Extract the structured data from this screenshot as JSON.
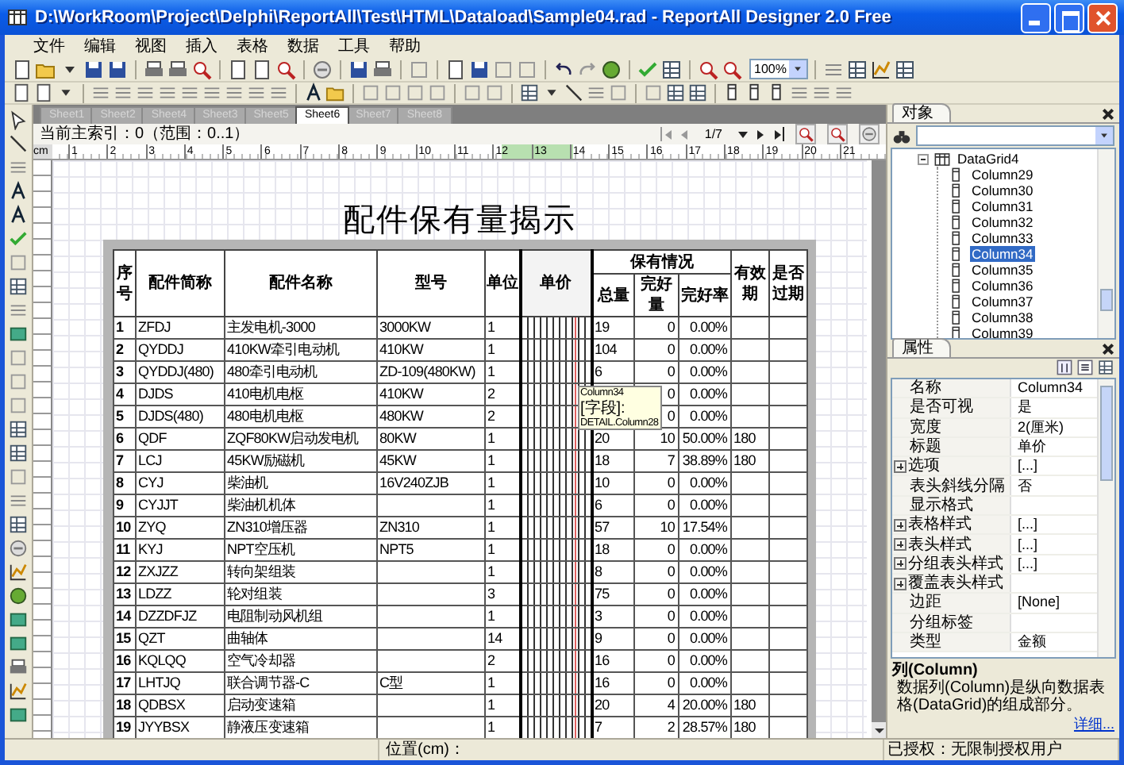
{
  "window": {
    "title": "D:\\WorkRoom\\Project\\Delphi\\ReportAll\\Test\\HTML\\Dataload\\Sample04.rad - ReportAll Designer 2.0 Free"
  },
  "menu": [
    "文件",
    "编辑",
    "视图",
    "插入",
    "表格",
    "数据",
    "工具",
    "帮助"
  ],
  "toolbar": {
    "zoom": "100%"
  },
  "sheet_tabs": [
    {
      "label": "Sheet1",
      "selected": false
    },
    {
      "label": "Sheet2",
      "selected": false
    },
    {
      "label": "Sheet4",
      "selected": false
    },
    {
      "label": "Sheet3",
      "selected": false
    },
    {
      "label": "Sheet5",
      "selected": false
    },
    {
      "label": "Sheet6",
      "selected": true
    },
    {
      "label": "Sheet7",
      "selected": false
    },
    {
      "label": "Sheet8",
      "selected": false
    }
  ],
  "info_bar": {
    "index_text": "当前主索引：0（范围：0..1）",
    "page": "1/7"
  },
  "ruler": {
    "unit": "cm",
    "marks": [
      "1",
      "2",
      "3",
      "4",
      "5",
      "6",
      "7",
      "8",
      "9",
      "10",
      "11",
      "12",
      "13",
      "14",
      "15",
      "16",
      "17",
      "18",
      "19",
      "20",
      "21"
    ]
  },
  "report": {
    "title": "配件保有量揭示",
    "header": [
      {
        "label": "序号",
        "selected": false
      },
      {
        "label": "配件简称",
        "selected": false
      },
      {
        "label": "配件名称",
        "selected": false
      },
      {
        "label": "型号",
        "selected": false
      },
      {
        "label": "单位",
        "selected": false
      },
      {
        "label": "单价",
        "selected": true
      },
      {
        "label": "保有情况",
        "children": [
          {
            "label": "总量",
            "selected": false
          },
          {
            "label": "完好量",
            "selected": false
          },
          {
            "label": "完好率",
            "selected": false
          }
        ]
      },
      {
        "label": "有效期",
        "selected": false
      },
      {
        "label": "是否过期",
        "selected": false
      }
    ],
    "rows": [
      [
        "1",
        "ZFDJ",
        "主发电机-3000",
        "3000KW",
        "1",
        null,
        "19",
        "0",
        "0.00%",
        null,
        null
      ],
      [
        "2",
        "QYDDJ",
        "410KW牵引电动机",
        "410KW",
        "1",
        null,
        "104",
        "0",
        "0.00%",
        null,
        null
      ],
      [
        "3",
        "QYDDJ(480)",
        "480牵引电动机",
        "ZD-109(480KW)",
        "1",
        null,
        "6",
        "0",
        "0.00%",
        null,
        null
      ],
      [
        "4",
        "DJDS",
        "410电机电枢",
        "410KW",
        "2",
        null,
        null,
        "0",
        "0.00%",
        null,
        null
      ],
      [
        "5",
        "DJDS(480)",
        "480电机电枢",
        "480KW",
        "2",
        null,
        null,
        "0",
        "0.00%",
        null,
        null
      ],
      [
        "6",
        "QDF",
        "ZQF80KW启动发电机",
        "80KW",
        "1",
        null,
        "20",
        "10",
        "50.00%",
        "180",
        null
      ],
      [
        "7",
        "LCJ",
        "45KW励磁机",
        "45KW",
        "1",
        null,
        "18",
        "7",
        "38.89%",
        "180",
        null
      ],
      [
        "8",
        "CYJ",
        "柴油机",
        "16V240ZJB",
        "1",
        null,
        "10",
        "0",
        "0.00%",
        null,
        null
      ],
      [
        "9",
        "CYJJT",
        "柴油机机体",
        null,
        "1",
        null,
        "6",
        "0",
        "0.00%",
        null,
        null
      ],
      [
        "10",
        "ZYQ",
        "ZN310增压器",
        "ZN310",
        "1",
        null,
        "57",
        "10",
        "17.54%",
        null,
        null
      ],
      [
        "11",
        "KYJ",
        "NPT空压机",
        "NPT5",
        "1",
        null,
        "18",
        "0",
        "0.00%",
        null,
        null
      ],
      [
        "12",
        "ZXJZZ",
        "转向架组装",
        null,
        "1",
        null,
        "8",
        "0",
        "0.00%",
        null,
        null
      ],
      [
        "13",
        "LDZZ",
        "轮对组装",
        null,
        "3",
        null,
        "75",
        "0",
        "0.00%",
        null,
        null
      ],
      [
        "14",
        "DZZDFJZ",
        "电阻制动风机组",
        null,
        "1",
        null,
        "3",
        "0",
        "0.00%",
        null,
        null
      ],
      [
        "15",
        "QZT",
        "曲轴体",
        null,
        "14",
        null,
        "9",
        "0",
        "0.00%",
        null,
        null
      ],
      [
        "16",
        "KQLQQ",
        "空气冷却器",
        null,
        "2",
        null,
        "16",
        "0",
        "0.00%",
        null,
        null
      ],
      [
        "17",
        "LHTJQ",
        "联合调节器-C",
        "C型",
        "1",
        null,
        "16",
        "0",
        "0.00%",
        null,
        null
      ],
      [
        "18",
        "QDBSX",
        "启动变速箱",
        null,
        "1",
        null,
        "20",
        "4",
        "20.00%",
        "180",
        null
      ],
      [
        "19",
        "JYYBSX",
        "静液压变速箱",
        null,
        "1",
        null,
        "7",
        "2",
        "28.57%",
        "180",
        null
      ]
    ]
  },
  "tooltip": {
    "lines": [
      "Column34",
      "[字段]:",
      "DETAIL.Column28"
    ]
  },
  "object_panel": {
    "tab": "对象",
    "tree": [
      {
        "label": "DataGrid4",
        "expanded": true,
        "children": [
          {
            "label": "Column29",
            "selected": false
          },
          {
            "label": "Column30",
            "selected": false
          },
          {
            "label": "Column31",
            "selected": false
          },
          {
            "label": "Column32",
            "selected": false
          },
          {
            "label": "Column33",
            "selected": false
          },
          {
            "label": "Column34",
            "selected": true
          },
          {
            "label": "Column35",
            "selected": false
          },
          {
            "label": "Column36",
            "selected": false
          },
          {
            "label": "Column37",
            "selected": false
          },
          {
            "label": "Column38",
            "selected": false
          },
          {
            "label": "Column39",
            "selected": false
          }
        ]
      }
    ]
  },
  "property_panel": {
    "tab": "属性",
    "properties": [
      {
        "name": "名称",
        "value": "Column34",
        "expandable": false
      },
      {
        "name": "是否可视",
        "value": "是",
        "expandable": false
      },
      {
        "name": "宽度",
        "value": "2(厘米)",
        "expandable": false
      },
      {
        "name": "标题",
        "value": "单价",
        "expandable": false
      },
      {
        "name": "选项",
        "value": "[...]",
        "expandable": true
      },
      {
        "name": "表头斜线分隔",
        "value": "否",
        "expandable": false
      },
      {
        "name": "显示格式",
        "expandable": false
      },
      {
        "name": "表格样式",
        "value": "[...]",
        "expandable": true
      },
      {
        "name": "表头样式",
        "value": "[...]",
        "expandable": true
      },
      {
        "name": "分组表头样式",
        "value": "[...]",
        "expandable": true
      },
      {
        "name": "覆盖表头样式",
        "expandable": true
      },
      {
        "name": "边距",
        "value": "[None]",
        "expandable": false
      },
      {
        "name": "分组标签",
        "expandable": false
      },
      {
        "name": "类型",
        "value": "金额",
        "expandable": false
      }
    ],
    "description": {
      "title": "列(Column)",
      "text": "数据列(Column)是纵向数据表格(DataGrid)的组成部分。",
      "link": "详细..."
    }
  },
  "status_bar": {
    "position_label": "位置(cm)：",
    "license": "已授权：无限制授权用户"
  }
}
